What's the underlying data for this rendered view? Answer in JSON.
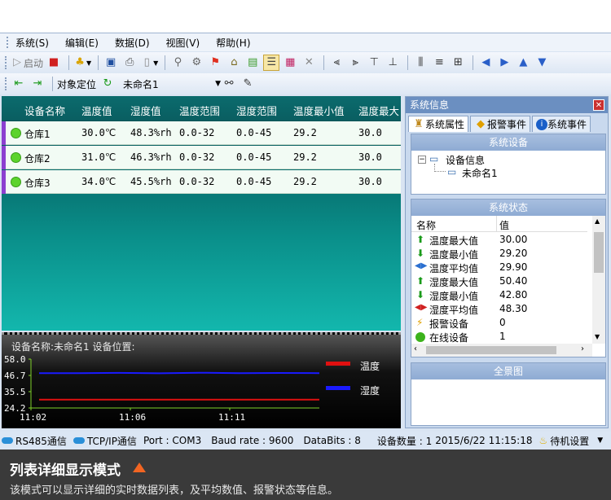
{
  "menu": [
    "系统(S)",
    "编辑(E)",
    "数据(D)",
    "视图(V)",
    "帮助(H)"
  ],
  "toolbar": {
    "start_label": "启动",
    "locate_label": "对象定位",
    "object_combo_value": "未命名1"
  },
  "table": {
    "columns": [
      "设备名称",
      "温度值",
      "湿度值",
      "温度范围",
      "湿度范围",
      "温度最小值",
      "温度最大"
    ],
    "rows": [
      [
        "仓库1",
        "30.0℃",
        "48.3%rh",
        "0.0-32",
        "0.0-45",
        "29.2",
        "30.0"
      ],
      [
        "仓库2",
        "31.0℃",
        "46.3%rh",
        "0.0-32",
        "0.0-45",
        "29.2",
        "30.0"
      ],
      [
        "仓库3",
        "34.0℃",
        "45.5%rh",
        "0.0-32",
        "0.0-45",
        "29.2",
        "30.0"
      ]
    ]
  },
  "trend": {
    "header": "设备名称:未命名1   设备位置:",
    "legend_temp": "温度",
    "legend_humi": "湿度",
    "temp_color": "#e01010",
    "humi_color": "#1a1aff"
  },
  "chart_data": {
    "type": "line",
    "x_ticks": [
      "11:02",
      "11:06",
      "11:11"
    ],
    "y_ticks": [
      "58.0",
      "46.7",
      "35.5",
      "24.2"
    ],
    "ylim": [
      24.2,
      58.0
    ],
    "series": [
      {
        "name": "温度",
        "values": [
          30.0,
          30.0,
          30.0,
          30.0,
          30.0,
          30.0,
          30.0,
          30.0
        ]
      },
      {
        "name": "湿度",
        "values": [
          48.3,
          48.3,
          48.5,
          48.2,
          48.6,
          48.3,
          48.4,
          48.3
        ]
      }
    ]
  },
  "statusbar": {
    "rs485": "RS485通信",
    "tcp": "TCP/IP通信",
    "port": "Port : COM3",
    "baud": "Baud rate  : 9600",
    "databits": "DataBits : 8",
    "devices": "设备数量 : 1",
    "datetime": "2015/6/22 11:15:18",
    "standby": "待机设置"
  },
  "panel": {
    "title": "系统信息",
    "tabs": [
      "系统属性",
      "报警事件",
      "系统事件"
    ],
    "devices_header": "系统设备",
    "tree_root": "设备信息",
    "tree_child": "未命名1",
    "status_header": "系统状态",
    "col_name": "名称",
    "col_value": "值",
    "status_rows": [
      {
        "name": "温度最大值",
        "value": "30.00"
      },
      {
        "name": "温度最小值",
        "value": "29.20"
      },
      {
        "name": "温度平均值",
        "value": "29.90"
      },
      {
        "name": "湿度最大值",
        "value": "50.40"
      },
      {
        "name": "湿度最小值",
        "value": "42.80"
      },
      {
        "name": "湿度平均值",
        "value": "48.30"
      },
      {
        "name": "报警设备",
        "value": "0"
      },
      {
        "name": "在线设备",
        "value": "1"
      }
    ],
    "overview_header": "全景图"
  },
  "caption": {
    "title": "列表详细显示模式",
    "desc": "该模式可以显示详细的实时数据列表，及平均数值、报警状态等信息。"
  }
}
